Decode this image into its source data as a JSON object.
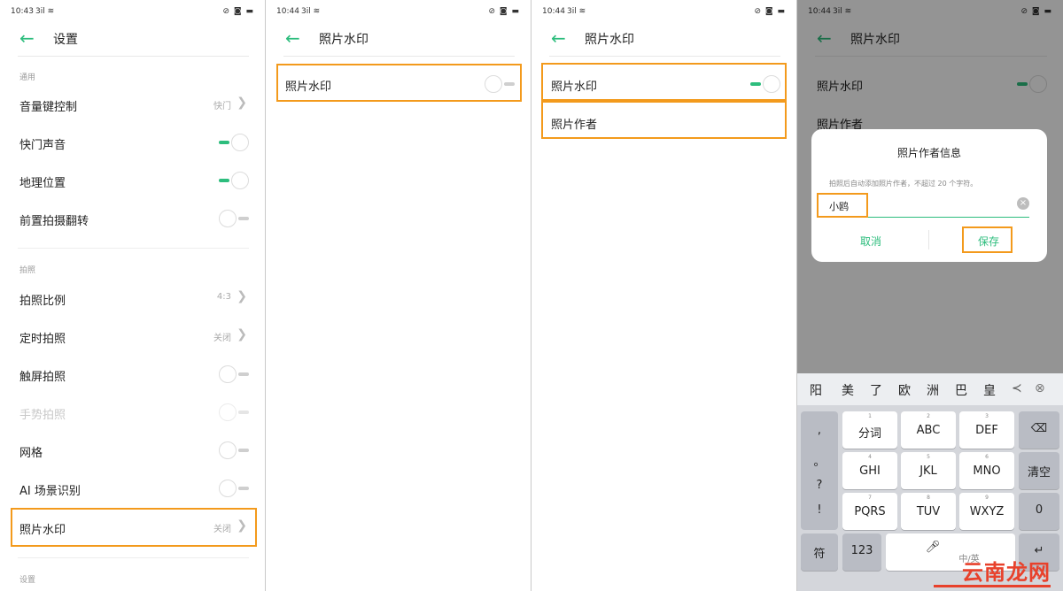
{
  "status_bar": [
    {
      "time": "10:43",
      "signal": "3il ≋",
      "right_icons": "⊘ ◙ ▬"
    },
    {
      "time": "10:44",
      "signal": "3il ≋",
      "right_icons": "⊘ ◙ ▬"
    },
    {
      "time": "10:44",
      "signal": "3il ≋",
      "right_icons": "⊘ ◙ ▬"
    },
    {
      "time": "10:44",
      "signal": "3il ≋",
      "right_icons": "⊘ ◙ ▬"
    }
  ],
  "panel1": {
    "title": "设置",
    "section_general": "通用",
    "section_photo": "拍照",
    "section_bottom": "设置",
    "items": {
      "volume_key": {
        "label": "音量键控制",
        "value": "快门"
      },
      "shutter_sound": {
        "label": "快门声音",
        "state": "on"
      },
      "location": {
        "label": "地理位置",
        "state": "on"
      },
      "front_flip": {
        "label": "前置拍摄翻转",
        "state": "off"
      },
      "ratio": {
        "label": "拍照比例",
        "value": "4:3"
      },
      "timer": {
        "label": "定时拍照",
        "value": "关闭"
      },
      "touch_shot": {
        "label": "触屏拍照",
        "state": "off"
      },
      "gesture_shot": {
        "label": "手势拍照",
        "state": "off"
      },
      "grid": {
        "label": "网格",
        "state": "off"
      },
      "ai_scene": {
        "label": "AI 场景识别",
        "state": "off"
      },
      "watermark": {
        "label": "照片水印",
        "value": "关闭"
      }
    }
  },
  "panel2": {
    "title": "照片水印",
    "watermark_label": "照片水印",
    "watermark_state": "off"
  },
  "panel3": {
    "title": "照片水印",
    "watermark_label": "照片水印",
    "watermark_state": "on",
    "author_label": "照片作者"
  },
  "panel4": {
    "title": "照片水印",
    "watermark_label": "照片水印",
    "watermark_state": "on",
    "author_label": "照片作者",
    "dialog": {
      "title": "照片作者信息",
      "hint": "拍照后自动添加照片作者，不超过 20 个字符。",
      "input_value": "小鸥",
      "cancel": "取消",
      "save": "保存"
    },
    "keyboard": {
      "candidates": [
        "阳",
        "美",
        "了",
        "欧",
        "洲",
        "巴",
        "皇"
      ],
      "punct": [
        ",",
        "。",
        "?",
        "!"
      ],
      "rows": [
        [
          {
            "num": "1",
            "label": "分词"
          },
          {
            "num": "2",
            "label": "ABC"
          },
          {
            "num": "3",
            "label": "DEF"
          }
        ],
        [
          {
            "num": "4",
            "label": "GHI"
          },
          {
            "num": "5",
            "label": "JKL"
          },
          {
            "num": "6",
            "label": "MNO"
          }
        ],
        [
          {
            "num": "7",
            "label": "PQRS"
          },
          {
            "num": "8",
            "label": "TUV"
          },
          {
            "num": "9",
            "label": "WXYZ"
          }
        ]
      ],
      "right_keys": [
        "清空",
        "0"
      ],
      "symbol_key": "符",
      "num_key": "123",
      "space_label": "中/英"
    }
  },
  "site_watermark": "云南龙网",
  "colors": {
    "accent": "#2dbd7d",
    "highlight": "#f39a1c",
    "watermark": "#e8412b"
  }
}
